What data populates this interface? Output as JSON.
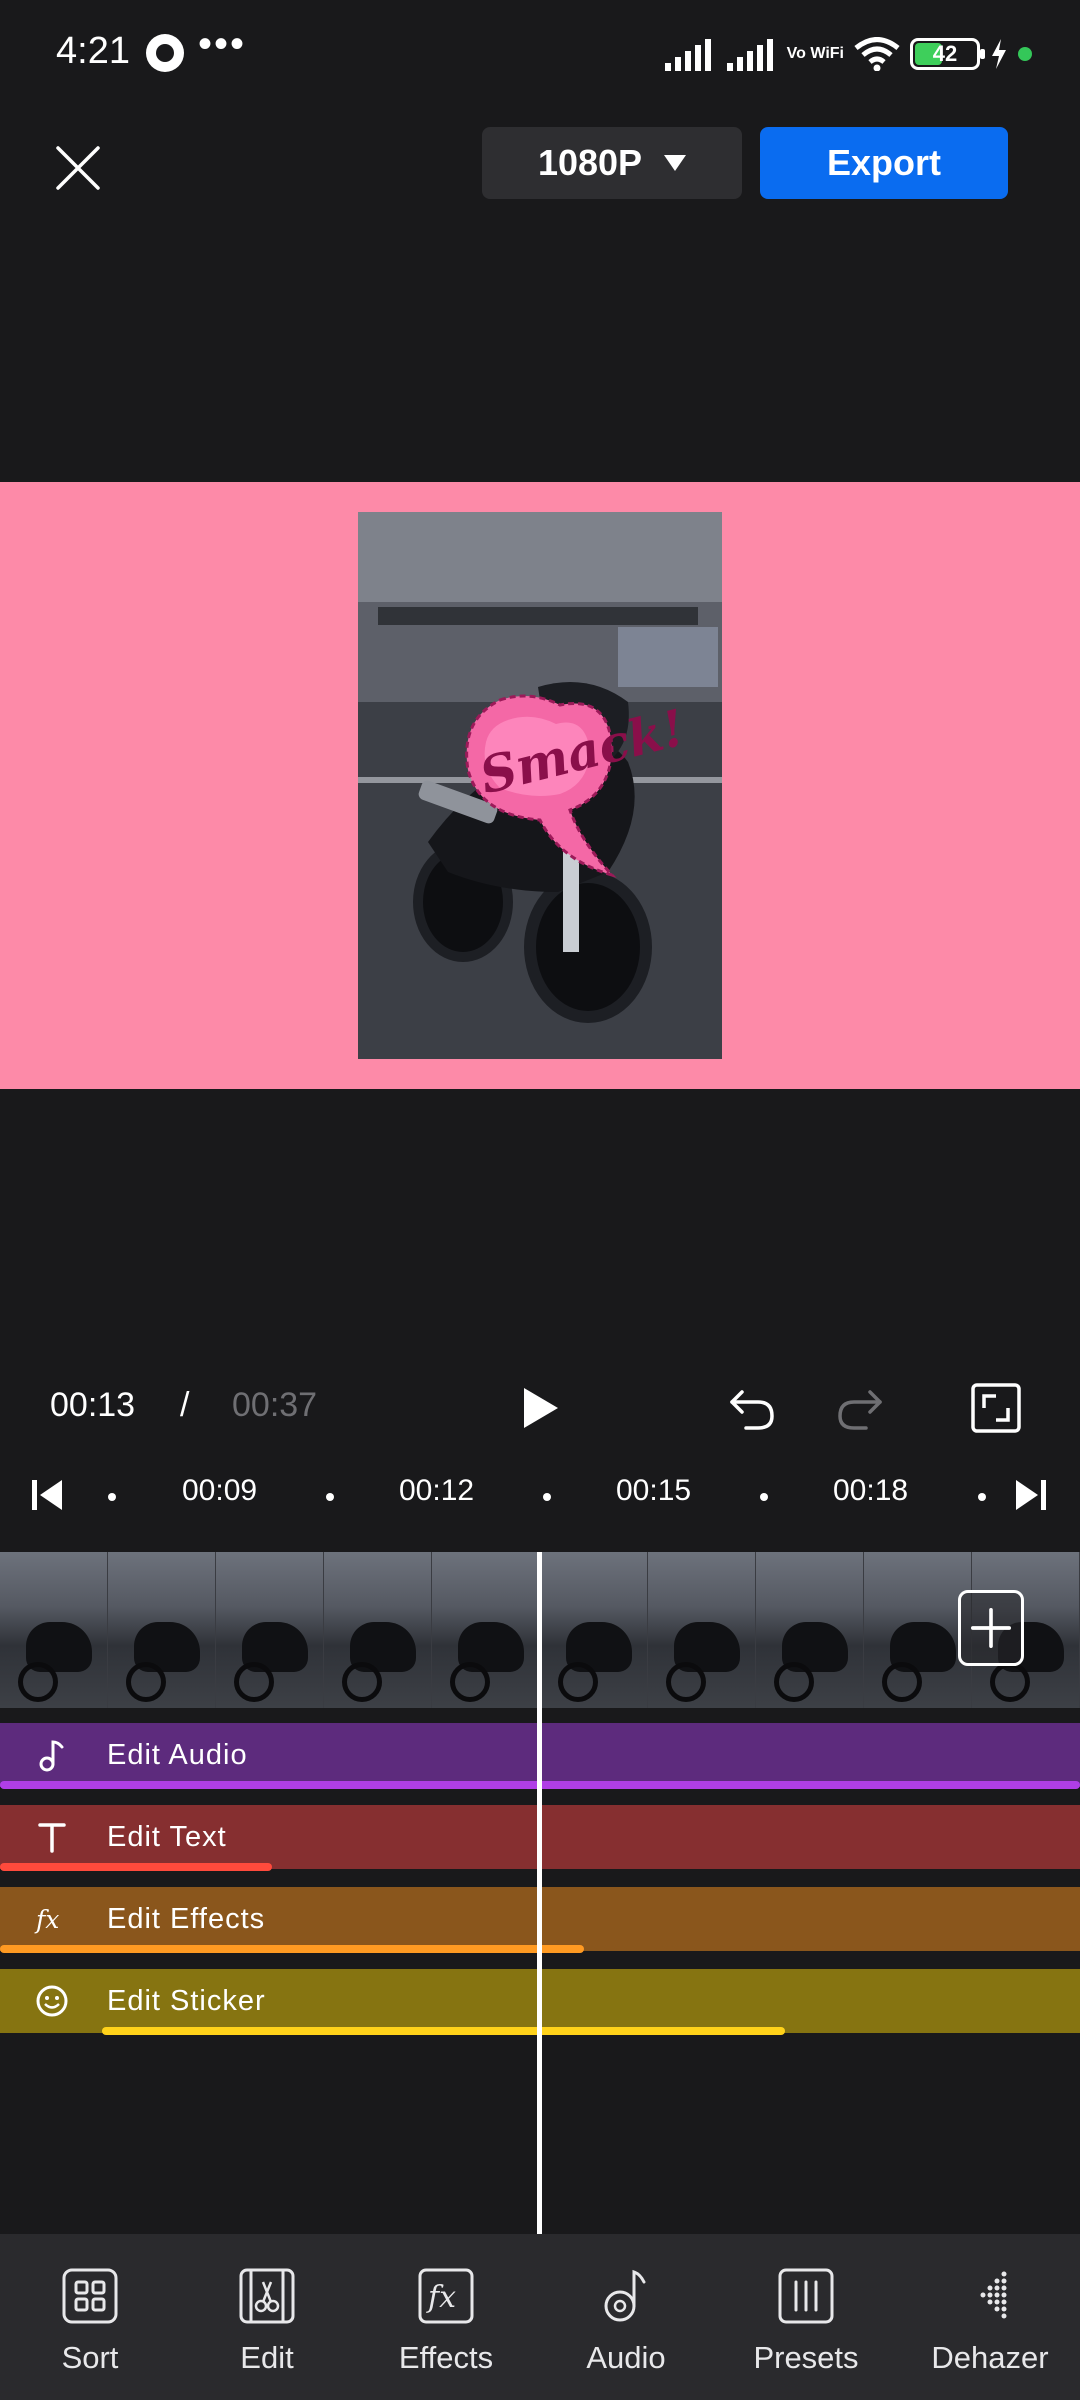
{
  "status": {
    "time": "4:21",
    "more": "•••",
    "network": "Vo WiFi",
    "battery": "42"
  },
  "toolbar": {
    "quality": "1080P",
    "export": "Export"
  },
  "preview": {
    "background": "#fd8aa8",
    "sticker_text": "Smack!"
  },
  "playback": {
    "current": "00:13",
    "separator": "/",
    "total": "00:37"
  },
  "ruler": {
    "ticks": [
      "00:09",
      "00:12",
      "00:15",
      "00:18"
    ]
  },
  "tracks": {
    "audio": {
      "label": "Edit Audio",
      "color": "#5d2b7d",
      "accent": "#b03ee6"
    },
    "text": {
      "label": "Edit Text",
      "color": "#862f30",
      "accent": "#ff4a3c"
    },
    "effects": {
      "label": "Edit Effects",
      "color": "#8a561c",
      "accent": "#ff9a22"
    },
    "sticker": {
      "label": "Edit Sticker",
      "color": "#867411",
      "accent": "#ffd21a"
    }
  },
  "nav": {
    "sort": "Sort",
    "edit": "Edit",
    "effects": "Effects",
    "audio": "Audio",
    "presets": "Presets",
    "dehazer": "Dehazer"
  }
}
